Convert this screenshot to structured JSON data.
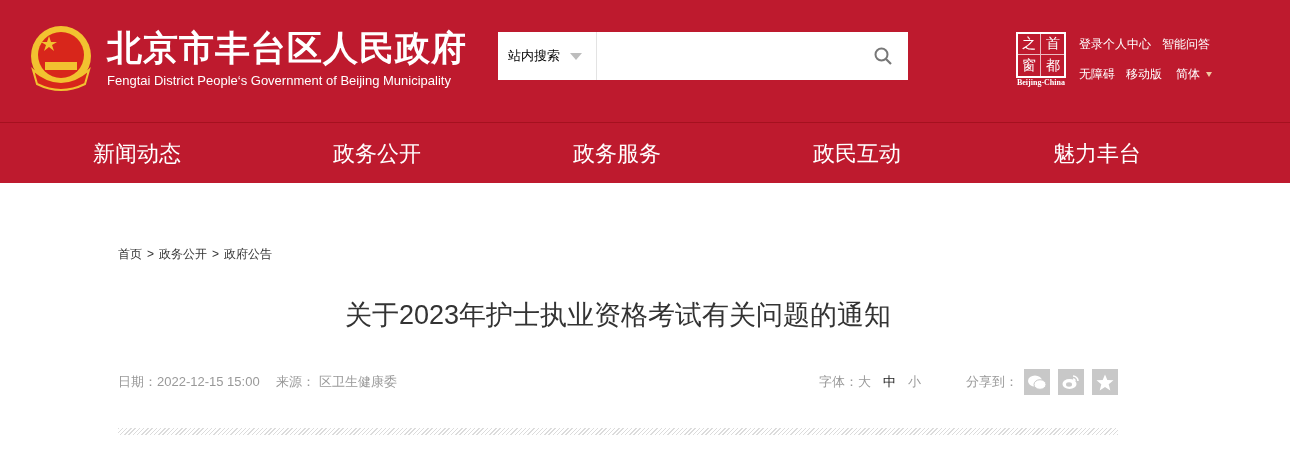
{
  "header": {
    "site_title": "北京市丰台区人民政府",
    "site_subtitle": "Fengtai District People‘s Government of Beijing Municipality",
    "search": {
      "scope": "站内搜索"
    },
    "badge": {
      "chars": [
        "之",
        "首",
        "窗",
        "都"
      ],
      "caption": "Beijing-China"
    },
    "top_links": [
      [
        "登录个人中心",
        "智能问答"
      ],
      [
        "无障碍",
        "移动版"
      ]
    ],
    "language": {
      "label": "简体",
      "expanded": false
    }
  },
  "nav": [
    "新闻动态",
    "政务公开",
    "政务服务",
    "政民互动",
    "魅力丰台"
  ],
  "breadcrumb": [
    "首页",
    "政务公开",
    "政府公告"
  ],
  "breadcrumb_separator": ">",
  "article": {
    "title": "关于2023年护士执业资格考试有关问题的通知",
    "date_label": "日期：",
    "date": "2022-12-15 15:00",
    "source_label": "来源：",
    "source": "区卫生健康委",
    "font_size_label": "字体：",
    "font_sizes": [
      {
        "label": "大",
        "selected": false
      },
      {
        "label": "中",
        "selected": true
      },
      {
        "label": "小",
        "selected": false
      }
    ],
    "share_label": "分享到：",
    "share": [
      {
        "kind": "wechat"
      },
      {
        "kind": "weibo"
      },
      {
        "kind": "favorite"
      }
    ]
  }
}
